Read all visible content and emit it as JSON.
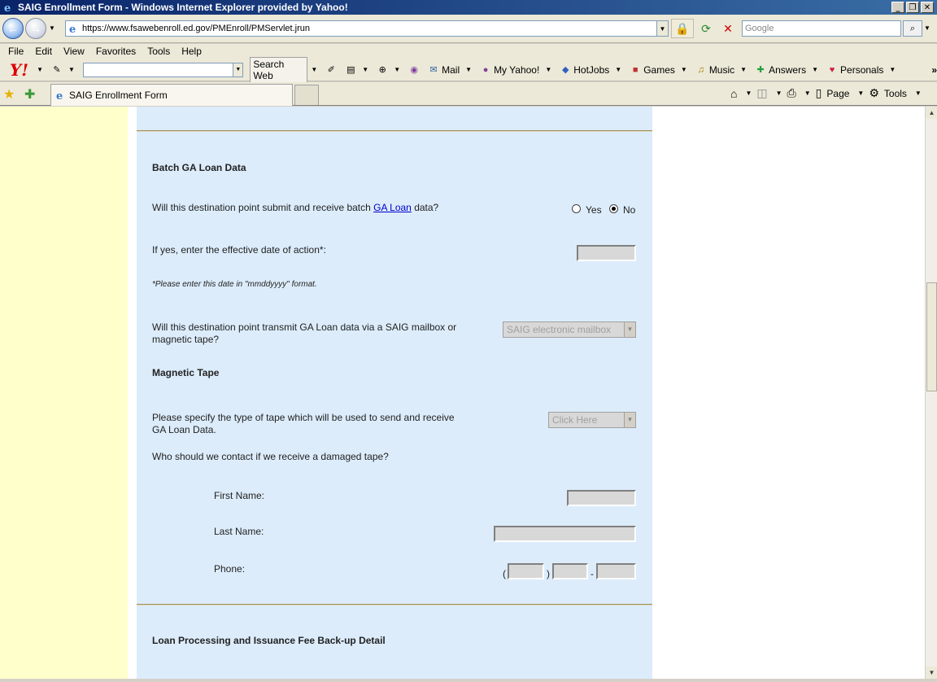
{
  "window": {
    "title": "SAIG Enrollment Form - Windows Internet Explorer provided by Yahoo!",
    "controls": [
      "_",
      "❐",
      "✕"
    ]
  },
  "address": {
    "url": "https://www.fsawebenroll.ed.gov/PMEnroll/PMServlet.jrun",
    "search_placeholder": "Google"
  },
  "menu": [
    "File",
    "Edit",
    "View",
    "Favorites",
    "Tools",
    "Help"
  ],
  "yahoo_toolbar": {
    "search_web": "Search Web",
    "items": [
      "Mail",
      "My Yahoo!",
      "HotJobs",
      "Games",
      "Music",
      "Answers",
      "Personals"
    ],
    "more": "»"
  },
  "tabs": {
    "active_title": "SAIG Enrollment Form"
  },
  "command_bar": {
    "page": "Page",
    "tools": "Tools"
  },
  "form": {
    "batch_heading": "Batch GA Loan Data",
    "q_submit_prefix": "Will this destination point submit and receive batch ",
    "q_submit_link": "GA Loan",
    "q_submit_suffix": " data?",
    "radio_yes": "Yes",
    "radio_no": "No",
    "radio_selected": "No",
    "q_effective_date": "If yes, enter the effective date of action*:",
    "date_note": "*Please enter this date in \"mmddyyyy\" format.",
    "q_transmit_line1": "Will this destination point transmit GA Loan data via a SAIG mailbox or",
    "q_transmit_line2": "magnetic tape?",
    "transmit_value": "SAIG electronic mailbox",
    "magnetic_heading": "Magnetic Tape",
    "q_tape_line1": "Please specify the type of tape which will be used to send and receive",
    "q_tape_line2": "GA Loan Data.",
    "tape_value": "Click Here",
    "q_contact": "Who should we contact if we receive a damaged tape?",
    "first_name": "First Name:",
    "last_name": "Last Name:",
    "phone": "Phone:",
    "phone_open": "(",
    "phone_close": ")",
    "phone_dash": "-",
    "loan_heading": "Loan Processing and Issuance Fee Back-up Detail"
  }
}
